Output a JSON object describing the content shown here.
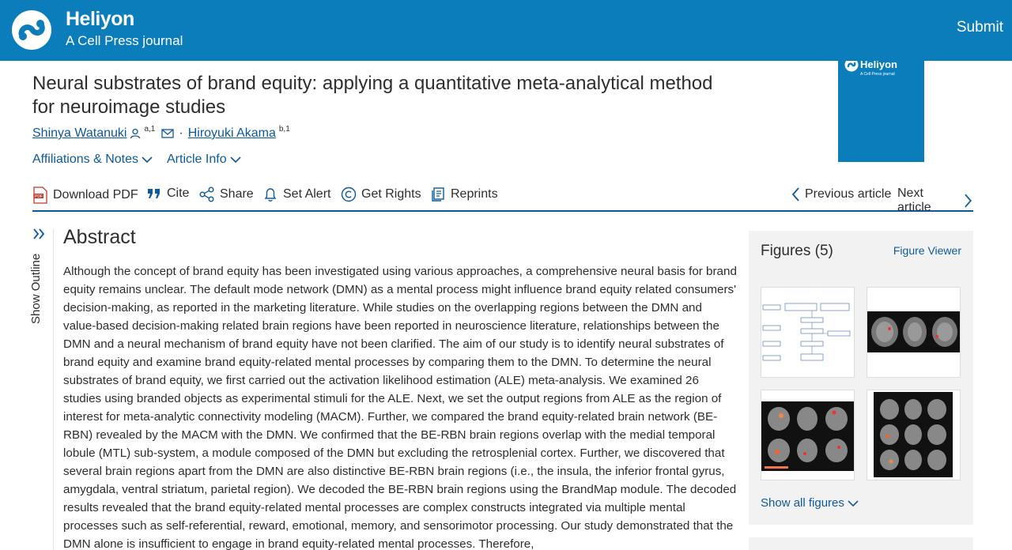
{
  "header": {
    "brand_name": "Heliyon",
    "brand_sub": "A Cell Press journal",
    "submit_label": "Submit",
    "accent_color": "#0c7dbb"
  },
  "cover": {
    "title": "Heliyon",
    "sub": "A Cell Press journal"
  },
  "article": {
    "title": "Neural substrates of brand equity: applying a quantitative meta-analytical method for neuroimage studies",
    "authors": [
      {
        "name": "Shinya Watanuki",
        "sup": "a,1"
      },
      {
        "name": "Hiroyuki Akama",
        "sup": "b,1"
      }
    ],
    "separator": "·",
    "affiliations_label": "Affiliations & Notes",
    "article_info_label": "Article Info"
  },
  "toolbar": {
    "download_pdf": "Download PDF",
    "cite": "Cite",
    "share": "Share",
    "set_alert": "Set Alert",
    "get_rights": "Get Rights",
    "reprints": "Reprints",
    "previous_article": "Previous article",
    "next_article": "Next article"
  },
  "outline": {
    "label": "Show Outline"
  },
  "abstract": {
    "heading": "Abstract",
    "body": "Although the concept of brand equity has been investigated using various approaches, a comprehensive neural basis for brand equity remains unclear. The default mode network (DMN) as a mental process might influence brand equity related consumers' decision-making, as reported in the marketing literature. While studies on the overlapping regions between the DMN and value-based decision-making related brain regions have been reported in neuroscience literature, relationships between the DMN and a neural mechanism of brand equity have not been clarified. The aim of our study is to identify neural substrates of brand equity and examine brand equity-related mental processes by comparing them to the DMN. To determine the neural substrates of brand equity, we first carried out the activation likelihood estimation (ALE) meta-analysis. We examined 26 studies using branded objects as experimental stimuli for the ALE. Next, we set the output regions from ALE as the region of interest for meta-analytic connectivity modeling (MACM). Further, we compared the brand equity-related brain network (BE-RBN) revealed by the MACM with the DMN. We confirmed that the BE-RBN brain regions overlap with the medial temporal lobule (MTL) sub-system, a module composed of the DMN but excluding the retrosplenial cortex. Further, we discovered that several brain regions apart from the DMN are also distinctive BE-RBN brain regions (i.e., the insula, the inferior frontal gyrus, amygdala, ventral striatum, parietal region). We decoded the BE-RBN brain regions using the BrandMap module. The decoded results revealed that the brand equity-related mental processes are complex constructs integrated via multiple mental processes such as self-referential, reward, emotional, memory, and sensorimotor processing. Our study demonstrated that the DMN alone is insufficient to engage in brand equity-related mental processes. Therefore,"
  },
  "figures": {
    "heading": "Figures (5)",
    "viewer_label": "Figure Viewer",
    "show_all_label": "Show all figures"
  }
}
